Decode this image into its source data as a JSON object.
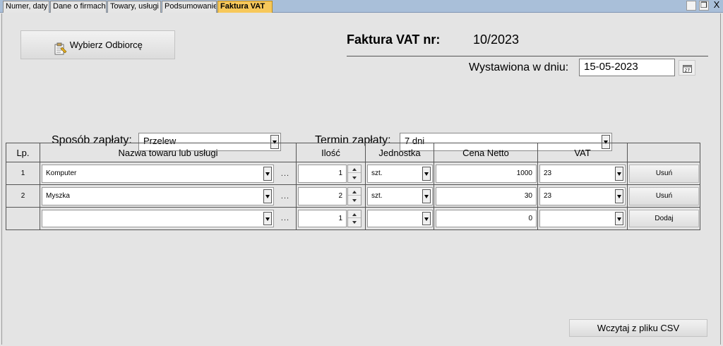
{
  "tabs": [
    {
      "label": "Numer, daty"
    },
    {
      "label": "Dane o firmach"
    },
    {
      "label": "Towary, usługi"
    },
    {
      "label": "Podsumowanie"
    },
    {
      "label": "Faktura VAT"
    }
  ],
  "window_controls": {
    "close": "X"
  },
  "header": {
    "select_recipient_label": "Wybierz Odbiorcę",
    "invoice_label": "Faktura VAT nr:",
    "invoice_number": "10/2023",
    "issue_date_label": "Wystawiona w dniu:",
    "issue_date_value": "15-05-2023"
  },
  "payment": {
    "method_label": "Sposób zapłaty:",
    "method_value": "Przelew",
    "term_label": "Termin zapłaty:",
    "term_value": "7 dni"
  },
  "table": {
    "headers": {
      "lp": "Lp.",
      "name": "Nazwa towaru lub usługi",
      "qty": "Ilość",
      "unit": "Jednostka",
      "price": "Cena Netto",
      "vat": "VAT"
    },
    "rows": [
      {
        "lp": "1",
        "name": "Komputer",
        "qty": "1",
        "unit": "szt.",
        "price": "1000",
        "vat": "23",
        "action": "Usuń"
      },
      {
        "lp": "2",
        "name": "Myszka",
        "qty": "2",
        "unit": "szt.",
        "price": "30",
        "vat": "23",
        "action": "Usuń"
      },
      {
        "lp": "",
        "name": "",
        "qty": "1",
        "unit": "",
        "price": "0",
        "vat": "",
        "action": "Dodaj"
      }
    ],
    "dots": "..."
  },
  "footer": {
    "import_csv_label": "Wczytaj z pliku CSV"
  },
  "icons": {
    "select_recipient": "clipboard-select-icon",
    "calendar": "calendar-icon"
  }
}
